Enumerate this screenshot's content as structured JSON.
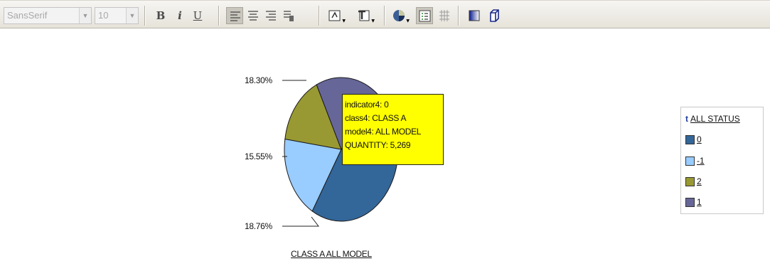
{
  "toolbar": {
    "font_family": "SansSerif",
    "font_size": "10",
    "bold_glyph": "B",
    "italic_glyph": "i",
    "underline_glyph": "U",
    "icons": [
      "align-left-icon",
      "align-center-icon",
      "align-right-icon",
      "format-icon",
      "chart-wizard-icon",
      "text-format-icon",
      "pie-chart-type-icon",
      "legend-toggle-icon",
      "grid-toggle-icon",
      "gradient-icon",
      "3d-icon"
    ]
  },
  "tooltip": {
    "line1": "indicator4: 0",
    "line2": "class4: CLASS A",
    "line3": "model4: ALL MODEL",
    "line4": "QUANTITY: 5,269"
  },
  "legend": {
    "sort_glyph": "t",
    "title": "ALL STATUS",
    "items": [
      {
        "label": "0",
        "color": "#336699"
      },
      {
        "label": "-1",
        "color": "#99ccff"
      },
      {
        "label": "2",
        "color": "#999933"
      },
      {
        "label": "1",
        "color": "#666699"
      }
    ]
  },
  "chart_data": {
    "type": "pie",
    "title": "CLASS A ALL MODEL",
    "legend_title": "ALL STATUS",
    "legend_position": "right",
    "slices": [
      {
        "label": "0",
        "value": 47.39,
        "color": "#336699"
      },
      {
        "label": "-1",
        "value": 18.76,
        "color": "#99ccff",
        "data_label": "18.76%"
      },
      {
        "label": "2",
        "value": 15.55,
        "color": "#999933",
        "data_label": "15.55%"
      },
      {
        "label": "1",
        "value": 18.3,
        "color": "#666699",
        "data_label": "18.30%"
      }
    ]
  }
}
